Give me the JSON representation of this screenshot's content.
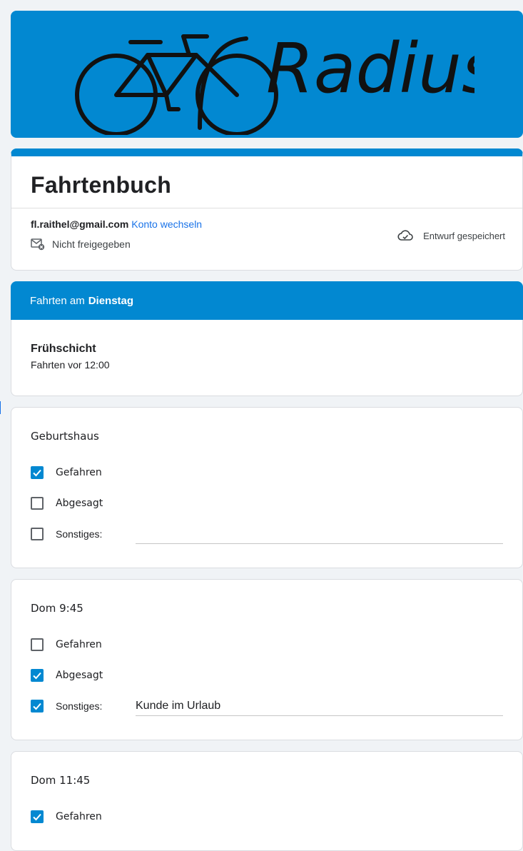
{
  "banner": {
    "logo_text": "Radius"
  },
  "form": {
    "title": "Fahrtenbuch",
    "email": "fl.raithel@gmail.com",
    "switch_account": "Konto wechseln",
    "not_shared": "Nicht freigegeben",
    "draft_status": "Entwurf gespeichert"
  },
  "section": {
    "header_prefix": "Fahrten am",
    "header_day": "Dienstag",
    "title": "Frühschicht",
    "description": "Fahrten vor 12:00"
  },
  "questions": [
    {
      "title": "Geburtshaus",
      "options": [
        {
          "label": "Gefahren",
          "checked": true
        },
        {
          "label": "Abgesagt",
          "checked": false
        },
        {
          "label": "Sonstiges:",
          "checked": false,
          "other_value": ""
        }
      ]
    },
    {
      "title": "Dom 9:45",
      "options": [
        {
          "label": "Gefahren",
          "checked": false
        },
        {
          "label": "Abgesagt",
          "checked": true
        },
        {
          "label": "Sonstiges:",
          "checked": true,
          "other_value": "Kunde im Urlaub"
        }
      ]
    },
    {
      "title": "Dom 11:45",
      "options": [
        {
          "label": "Gefahren",
          "checked": true
        }
      ]
    }
  ],
  "colors": {
    "accent": "#0288d1",
    "link": "#1a73e8",
    "background": "#f0f3f6"
  }
}
